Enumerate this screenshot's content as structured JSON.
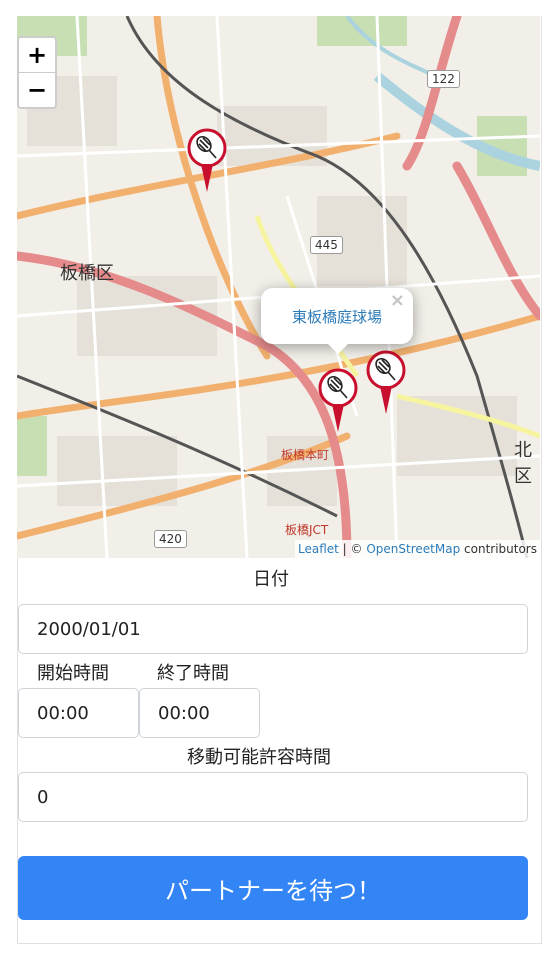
{
  "map": {
    "zoom_in": "+",
    "zoom_out": "−",
    "popup_text": "東板橋庭球場",
    "popup_close": "×",
    "attribution": {
      "leaflet": "Leaflet",
      "sep": " | © ",
      "osm": "OpenStreetMap",
      "suffix": " contributors"
    },
    "place_labels": {
      "itabashi_ku": "板橋区",
      "kita_ku": "北区",
      "road_445": "445",
      "road_420": "420",
      "road_122": "122",
      "itabashi_honcho": "板橋本町",
      "itabashi_jct": "板橋JCT"
    },
    "markers": [
      "tennis-court-marker",
      "tennis-court-marker",
      "tennis-court-marker"
    ],
    "colors": {
      "marker_red": "#c8102e",
      "popup_link": "#2d7bb8"
    }
  },
  "form": {
    "date_label": "日付",
    "date_value": "2000/01/01",
    "start_label": "開始時間",
    "start_value": "00:00",
    "end_label": "終了時間",
    "end_value": "00:00",
    "travel_label": "移動可能許容時間",
    "travel_value": "0",
    "submit_label": "パートナーを待つ！"
  },
  "colors": {
    "button": "#3385f5"
  }
}
